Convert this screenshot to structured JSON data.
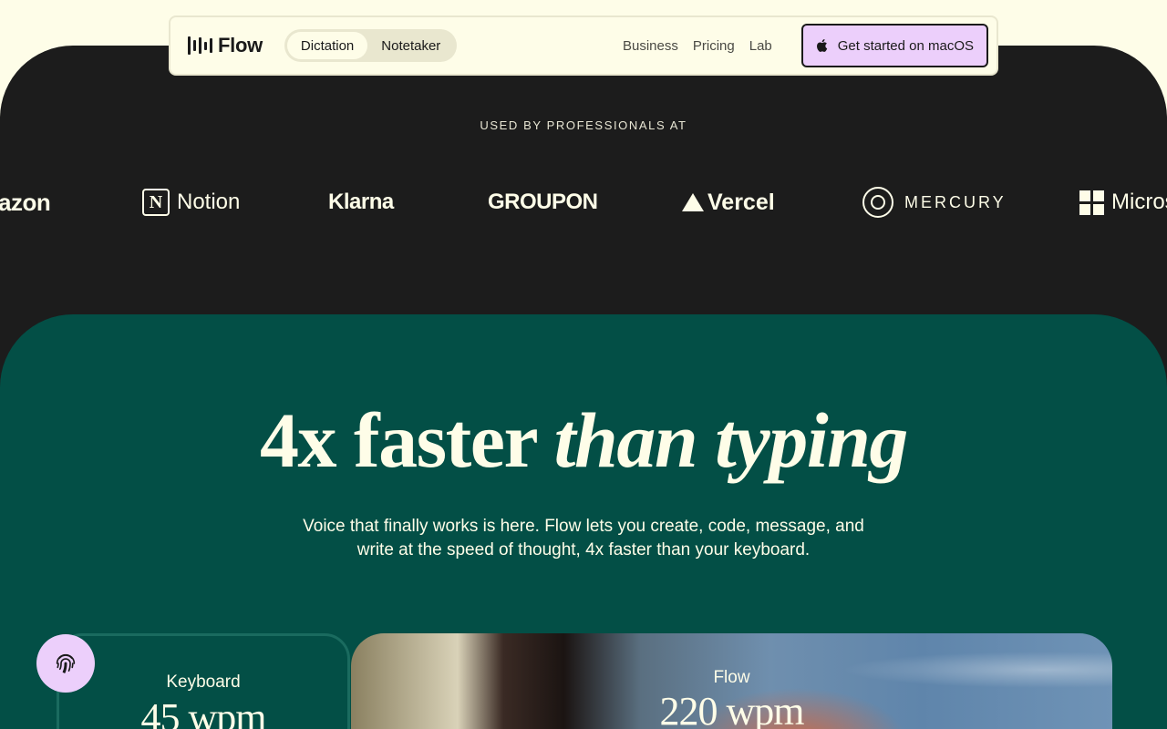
{
  "nav": {
    "logo_text": "Flow",
    "toggle": [
      {
        "label": "Dictation",
        "active": true
      },
      {
        "label": "Notetaker",
        "active": false
      }
    ],
    "links": [
      "Business",
      "Pricing",
      "Lab"
    ],
    "cta_label": "Get started on macOS"
  },
  "logos_section": {
    "eyebrow": "USED BY PROFESSIONALS AT",
    "brands": {
      "amazon": "azon",
      "notion": "Notion",
      "klarna": "Klarna",
      "groupon": "GROUPON",
      "vercel": "Vercel",
      "mercury": "MERCURY",
      "microsoft": "Micros"
    }
  },
  "hero": {
    "headline_plain": "4x faster ",
    "headline_italic": "than typing",
    "subtitle": "Voice that finally works is here. Flow lets you create, code, message, and write at the speed of thought, 4x faster than your keyboard."
  },
  "comparison": {
    "keyboard": {
      "label": "Keyboard",
      "value": "45 wpm"
    },
    "flow": {
      "label": "Flow",
      "value": "220 wpm"
    }
  },
  "colors": {
    "cream": "#fefde8",
    "dark": "#1c1c1c",
    "green": "#034f46",
    "accent": "#eccffb"
  }
}
